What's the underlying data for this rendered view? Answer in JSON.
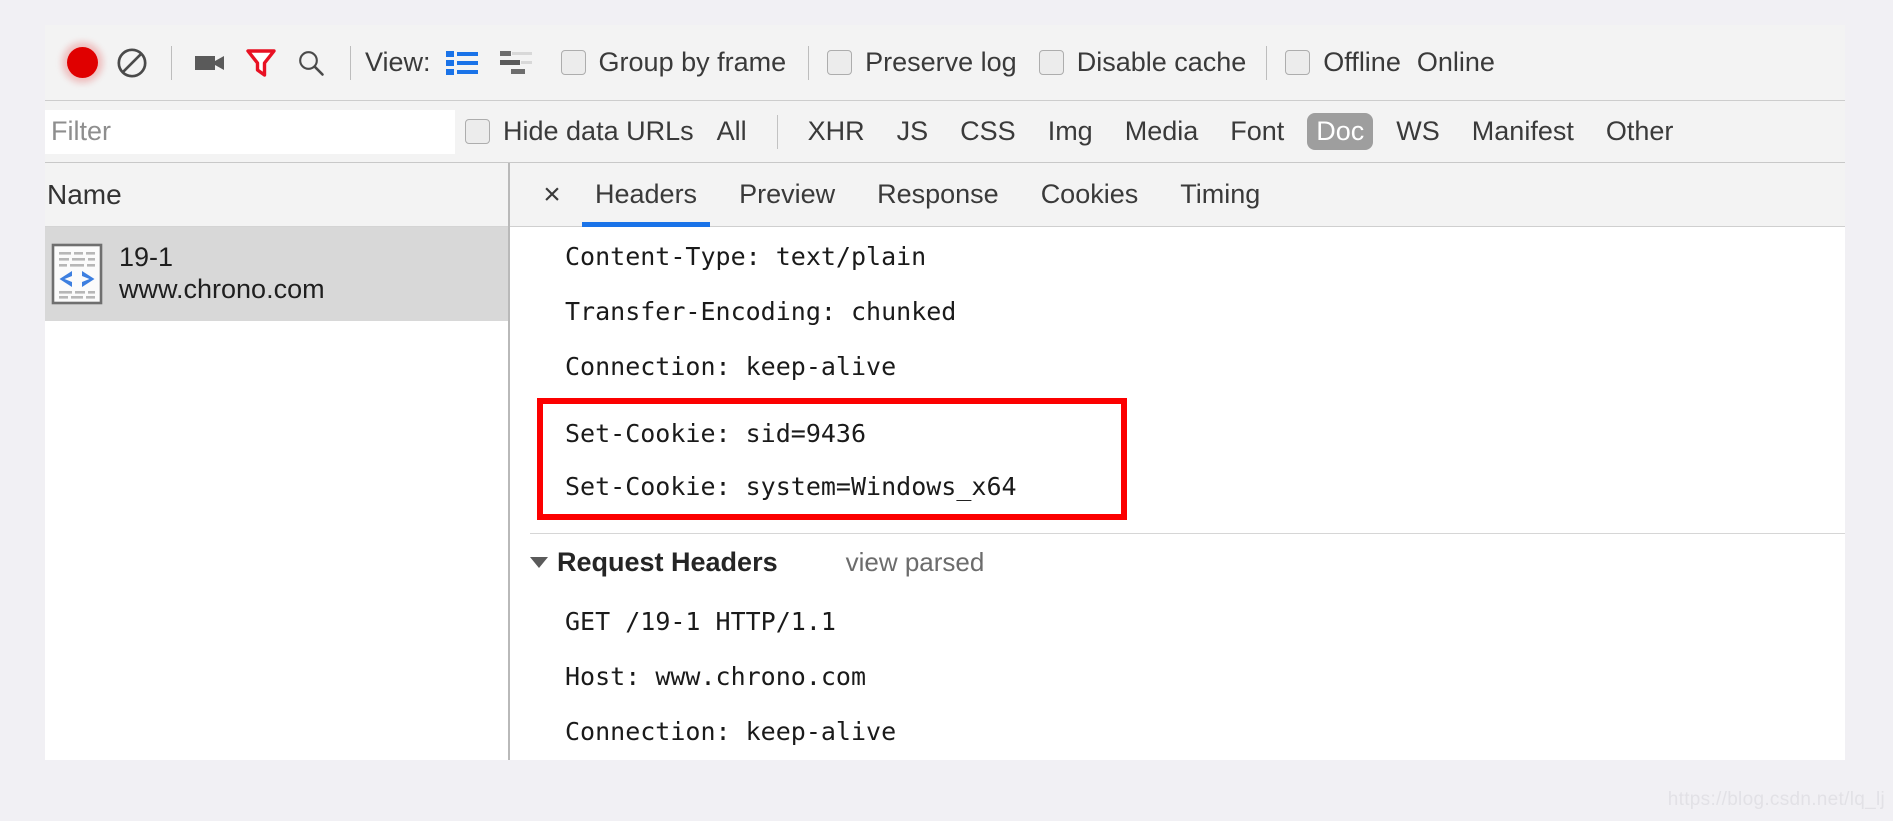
{
  "toolbar": {
    "record_icon": "record-circle-icon",
    "clear_icon": "clear-prohibited-icon",
    "camera_icon": "camera-filmstrip-icon",
    "filter_icon": "funnel-filter-icon",
    "search_icon": "search-magnifier-icon",
    "view_label": "View:",
    "list_view_icon": "list-view-icon",
    "waterfall_view_icon": "waterfall-view-icon",
    "group_by_frame": "Group by frame",
    "preserve_log": "Preserve log",
    "disable_cache": "Disable cache",
    "offline": "Offline",
    "online": "Online",
    "accent_record_color": "#e00000",
    "accent_filter_color": "#e81123"
  },
  "filterbar": {
    "filter_placeholder": "Filter",
    "filter_value": "",
    "hide_data_urls": "Hide data URLs",
    "types": [
      {
        "label": "All",
        "active": false
      },
      {
        "label": "XHR",
        "active": false
      },
      {
        "label": "JS",
        "active": false
      },
      {
        "label": "CSS",
        "active": false
      },
      {
        "label": "Img",
        "active": false
      },
      {
        "label": "Media",
        "active": false
      },
      {
        "label": "Font",
        "active": false
      },
      {
        "label": "Doc",
        "active": true
      },
      {
        "label": "WS",
        "active": false
      },
      {
        "label": "Manifest",
        "active": false
      },
      {
        "label": "Other",
        "active": false
      }
    ],
    "active_chip_bg": "#9e9e9e"
  },
  "sidebar": {
    "column_header": "Name",
    "requests": [
      {
        "icon": "document-code-icon",
        "name": "19-1",
        "host": "www.chrono.com",
        "selected": true
      }
    ]
  },
  "detail": {
    "close_label": "×",
    "tabs": [
      {
        "label": "Headers",
        "active": true
      },
      {
        "label": "Preview",
        "active": false
      },
      {
        "label": "Response",
        "active": false
      },
      {
        "label": "Cookies",
        "active": false
      },
      {
        "label": "Timing",
        "active": false
      }
    ],
    "active_tab_underline_color": "#1a73e8",
    "response_headers": [
      {
        "name": "Content-Type:",
        "value": "text/plain",
        "highlighted": false
      },
      {
        "name": "Transfer-Encoding:",
        "value": "chunked",
        "highlighted": false
      },
      {
        "name": "Connection:",
        "value": "keep-alive",
        "highlighted": false
      },
      {
        "name": "Set-Cookie:",
        "value": "sid=9436",
        "highlighted": true
      },
      {
        "name": "Set-Cookie:",
        "value": "system=Windows_x64",
        "highlighted": true
      }
    ],
    "request_headers_section": {
      "title": "Request Headers",
      "view_parsed": "view parsed",
      "expanded": true
    },
    "request_headers": [
      {
        "name": "GET",
        "value": "/19-1 HTTP/1.1"
      },
      {
        "name": "Host:",
        "value": "www.chrono.com"
      },
      {
        "name": "Connection:",
        "value": "keep-alive"
      }
    ],
    "annotation": {
      "shape": "rectangle",
      "color": "#fc0000",
      "covers": "Set-Cookie response headers"
    }
  },
  "watermark": {
    "text": "https://blog.csdn.net/lq_lj"
  }
}
